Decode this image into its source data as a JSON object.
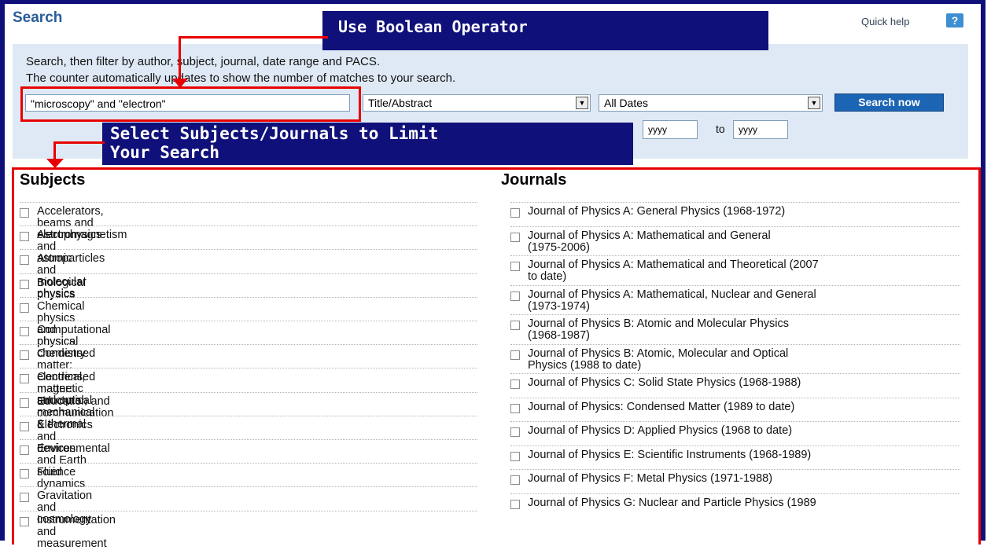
{
  "header": {
    "title": "Search",
    "quick_help": "Quick help",
    "help_glyph": "?"
  },
  "callouts": {
    "boolean": "Use Boolean Operator",
    "limit_line1": "Select Subjects/Journals to Limit",
    "limit_line2": "Your Search"
  },
  "instructions": {
    "line1": "Search, then filter by author, subject, journal, date range and PACS.",
    "line2": "The counter automatically updates to show the number of matches to your search."
  },
  "search": {
    "query": "\"microscopy\" and \"electron\"",
    "field_select": "Title/Abstract",
    "date_select": "All Dates",
    "submit_label": "Search now",
    "year_from_placeholder": "yyyy",
    "year_to_label": "to",
    "year_to_placeholder": "yyyy"
  },
  "subjects": {
    "heading": "Subjects",
    "items": [
      "Accelerators, beams and electromagnetism",
      "Astrophysics and astroparticles",
      "Atomic and molecular physics",
      "Biological physics",
      "Chemical physics and physical chemistry",
      "Computational physics",
      "Condensed matter: electrical, magnetic and optical",
      "Condensed matter: structural, mechanical & thermal",
      "Education and communication",
      "Electronics and devices",
      "Environmental and Earth science",
      "Fluid dynamics",
      "Gravitation and cosmology",
      "Instrumentation and measurement"
    ]
  },
  "journals": {
    "heading": "Journals",
    "items": [
      [
        "Journal of Physics A: General Physics (1968-1972)"
      ],
      [
        "Journal of Physics A: Mathematical and General",
        "(1975-2006)"
      ],
      [
        "Journal of Physics A: Mathematical and Theoretical (2007",
        "to date)"
      ],
      [
        "Journal of Physics A: Mathematical, Nuclear and General",
        "(1973-1974)"
      ],
      [
        "Journal of Physics B: Atomic and Molecular Physics",
        "(1968-1987)"
      ],
      [
        "Journal of Physics B: Atomic, Molecular and Optical",
        "Physics (1988 to date)"
      ],
      [
        "Journal of Physics C: Solid State Physics (1968-1988)"
      ],
      [
        "Journal of Physics: Condensed Matter (1989 to date)"
      ],
      [
        "Journal of Physics D: Applied Physics (1968 to date)"
      ],
      [
        "Journal of Physics E: Scientific Instruments (1968-1989)"
      ],
      [
        "Journal of Physics F: Metal Physics (1971-1988)"
      ],
      [
        "Journal of Physics G: Nuclear and Particle Physics (1989"
      ]
    ]
  },
  "colors": {
    "navy": "#10107a",
    "annotation_red": "#e80000",
    "panel": "#dfe9f5",
    "button": "#1c64b4"
  }
}
